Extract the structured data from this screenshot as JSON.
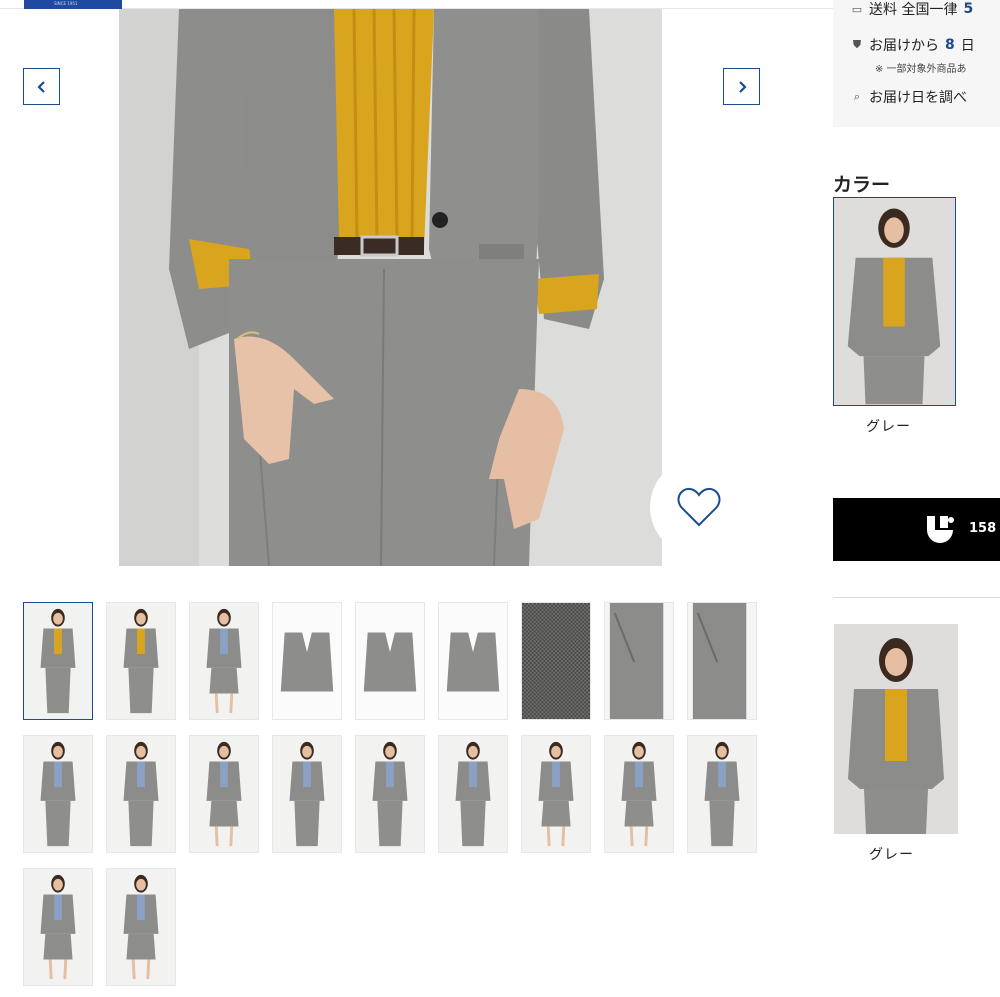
{
  "header": {
    "logo_text": "SINCE 1951"
  },
  "gallery": {
    "prev_label": "previous-image",
    "next_label": "next-image",
    "favorite_icon": "heart-icon",
    "thumb_count": 20,
    "selected_index": 0
  },
  "shipping": {
    "row1": "送料 全国一律",
    "row1_hl": "5",
    "row2_prefix": "お届けから",
    "row2_hl": "8",
    "row2_suffix": "日",
    "note": "※ 一部対象外商品あ",
    "row3": "お届け日を調べ"
  },
  "color": {
    "title": "カラー",
    "options": [
      {
        "label": "グレー",
        "selected": true
      }
    ]
  },
  "app_banner": {
    "count": "158"
  },
  "recommend": [
    {
      "label": "グレー"
    }
  ],
  "colors": {
    "accent": "#1a4c8c",
    "mustard": "#d9a51e",
    "suit": "#8c8c8a"
  }
}
